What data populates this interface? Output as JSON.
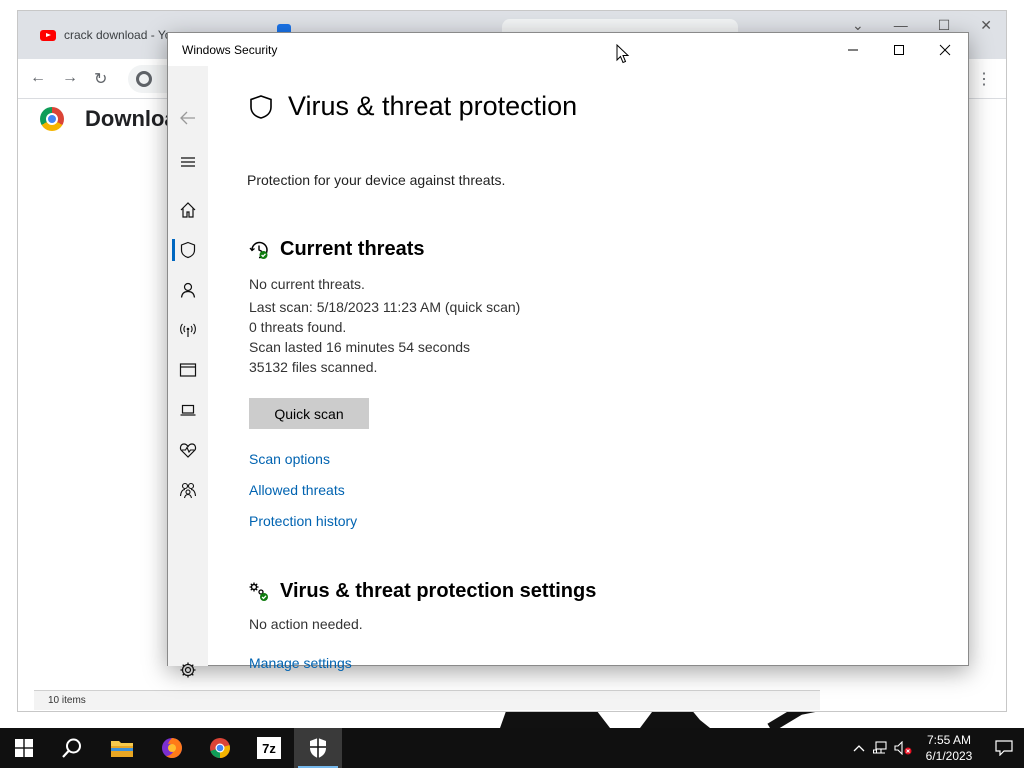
{
  "background_chrome": {
    "tab_title": "crack download - Yo",
    "page_title": "Downloa",
    "status_text": "10 items"
  },
  "window": {
    "title": "Windows Security",
    "minimize": "—",
    "maximize": "☐",
    "close": "✕"
  },
  "sidebar": {
    "items": [
      {
        "name": "back",
        "icon": "arrow-left-icon"
      },
      {
        "name": "menu",
        "icon": "hamburger-icon"
      },
      {
        "name": "home",
        "icon": "home-icon"
      },
      {
        "name": "virus-threat-protection",
        "icon": "shield-icon",
        "active": true
      },
      {
        "name": "account-protection",
        "icon": "person-icon"
      },
      {
        "name": "firewall-network",
        "icon": "wifi-antenna-icon"
      },
      {
        "name": "app-browser-control",
        "icon": "browser-window-icon"
      },
      {
        "name": "device-security",
        "icon": "laptop-icon"
      },
      {
        "name": "device-performance",
        "icon": "heart-pulse-icon"
      },
      {
        "name": "family-options",
        "icon": "family-icon"
      },
      {
        "name": "settings",
        "icon": "gear-icon"
      }
    ]
  },
  "page": {
    "title": "Virus & threat protection",
    "subtitle": "Protection for your device against threats."
  },
  "current_threats": {
    "heading": "Current threats",
    "status": "No current threats.",
    "last_scan": "Last scan: 5/18/2023 11:23 AM (quick scan)",
    "threats_found": "0 threats found.",
    "scan_duration": "Scan lasted 16 minutes 54 seconds",
    "files_scanned": "35132 files scanned.",
    "quick_scan_button": "Quick scan",
    "links": [
      "Scan options",
      "Allowed threats",
      "Protection history"
    ]
  },
  "settings_section": {
    "heading": "Virus & threat protection settings",
    "status": "No action needed.",
    "manage_link": "Manage settings"
  },
  "taskbar": {
    "apps": [
      "File Explorer",
      "Firefox",
      "Chrome",
      "7-Zip",
      "Windows Security"
    ],
    "seven_zip_label": "7z",
    "time": "7:55 AM",
    "date": "6/1/2023"
  },
  "colors": {
    "link": "#0063b1",
    "accent": "#0067c0",
    "sidebar_bg": "#f2f2f2",
    "button_bg": "#cccccc",
    "taskbar_bg": "#101010"
  }
}
